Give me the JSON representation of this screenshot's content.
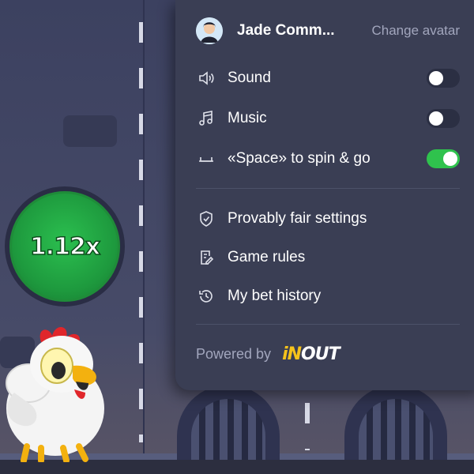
{
  "game": {
    "multiplier": "1.12x"
  },
  "menu": {
    "username": "Jade Comm...",
    "change_avatar": "Change avatar",
    "items": [
      {
        "label": "Sound",
        "icon": "speaker-icon",
        "toggle": false
      },
      {
        "label": "Music",
        "icon": "music-note-icon",
        "toggle": false
      },
      {
        "label": "«Space» to spin & go",
        "icon": "spacebar-icon",
        "toggle": true
      }
    ],
    "links": [
      {
        "label": "Provably fair settings",
        "icon": "shield-check-icon"
      },
      {
        "label": "Game rules",
        "icon": "document-edit-icon"
      },
      {
        "label": "My bet history",
        "icon": "history-clock-icon"
      }
    ],
    "powered_by": "Powered by",
    "brand_in": "iN",
    "brand_out": "OUT"
  },
  "colors": {
    "panel": "#3a3e54",
    "toggle_on": "#2fc24d",
    "multiplier_green": "#1e9a3e",
    "brand_yellow": "#f5c21b"
  }
}
